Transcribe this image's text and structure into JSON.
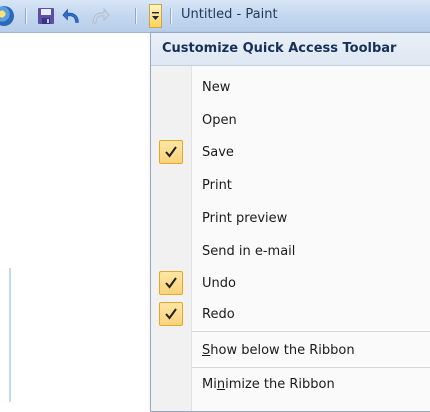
{
  "window": {
    "title": "Untitled - Paint"
  },
  "quick_access_toolbar": {
    "buttons": [
      "paint-app-icon",
      "save-icon",
      "undo-icon",
      "redo-icon",
      "customize-dropdown-icon"
    ]
  },
  "menu": {
    "header": "Customize Quick Access Toolbar",
    "items": [
      {
        "label": "New",
        "checked": false
      },
      {
        "label": "Open",
        "checked": false
      },
      {
        "label": "Save",
        "checked": true
      },
      {
        "label": "Print",
        "checked": false
      },
      {
        "label": "Print preview",
        "checked": false
      },
      {
        "label": "Send in e-mail",
        "checked": false
      },
      {
        "label": "Undo",
        "checked": true
      },
      {
        "label": "Redo",
        "checked": true
      }
    ],
    "show_below": {
      "prefix": "",
      "accel": "S",
      "suffix": "how below the Ribbon"
    },
    "minimize": {
      "prefix": "Mi",
      "accel": "n",
      "suffix": "imize the Ribbon"
    }
  },
  "colors": {
    "title_text": "#1e395b",
    "menu_header_text": "#15305a",
    "check_fill": "#fbd27b",
    "check_border": "#e3a92a"
  }
}
